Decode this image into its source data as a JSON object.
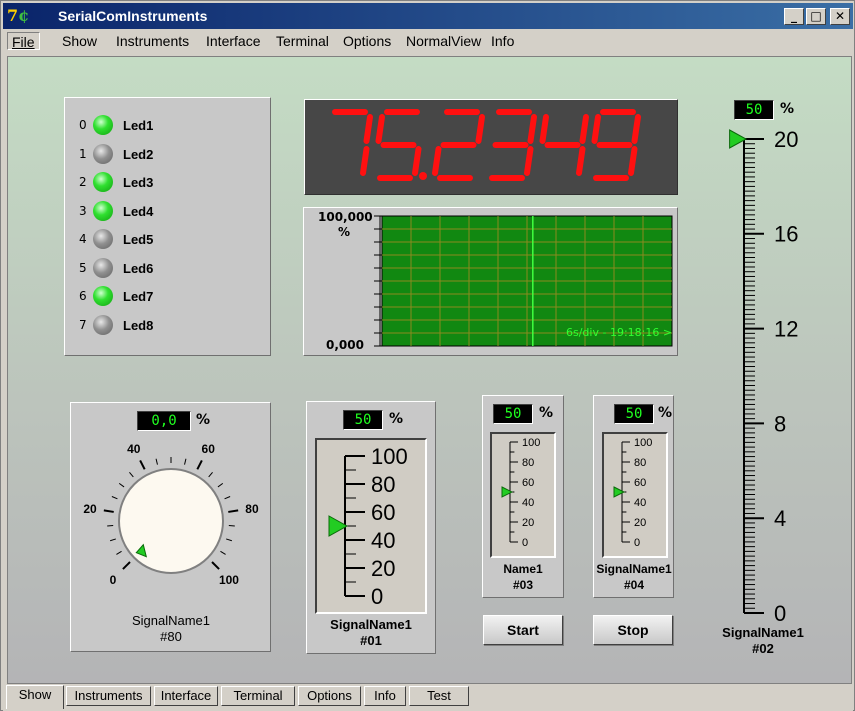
{
  "window": {
    "title": "SerialComInstruments",
    "min_glyph": "_",
    "max_glyph": "□",
    "close_glyph": "✕"
  },
  "menu": [
    {
      "label": "File"
    },
    {
      "label": "Show"
    },
    {
      "label": "Instruments"
    },
    {
      "label": "Interface"
    },
    {
      "label": "Terminal"
    },
    {
      "label": "Options"
    },
    {
      "label": "NormalView"
    },
    {
      "label": "Info"
    }
  ],
  "leds": [
    {
      "index": "0",
      "label": "Led1",
      "state": "on"
    },
    {
      "index": "1",
      "label": "Led2",
      "state": "off"
    },
    {
      "index": "2",
      "label": "Led3",
      "state": "on"
    },
    {
      "index": "3",
      "label": "Led4",
      "state": "on"
    },
    {
      "index": "4",
      "label": "Led5",
      "state": "off"
    },
    {
      "index": "5",
      "label": "Led6",
      "state": "off"
    },
    {
      "index": "6",
      "label": "Led7",
      "state": "on"
    },
    {
      "index": "7",
      "label": "Led8",
      "state": "off"
    }
  ],
  "seven_segment": {
    "value": "75.2349",
    "color": "#ff1010"
  },
  "scope": {
    "max_label": "100,000",
    "unit": "%",
    "min_label": "0,000",
    "timebase": "6s/div - 19:18:16 >"
  },
  "knob": {
    "value": "0,0",
    "unit": "%",
    "ticks": [
      "0",
      "20",
      "40",
      "60",
      "80",
      "100"
    ],
    "level": 0,
    "caption_name": "SignalName1",
    "caption_id": "#80"
  },
  "gauge01": {
    "value": "50",
    "unit": "%",
    "ticks": [
      "100",
      "80",
      "60",
      "40",
      "20",
      "0"
    ],
    "level": 50,
    "caption_name": "SignalName1",
    "caption_id": "#01"
  },
  "gauge03": {
    "value": "50",
    "unit": "%",
    "ticks": [
      "100",
      "80",
      "60",
      "40",
      "20",
      "0"
    ],
    "level": 50,
    "caption_name": "Name1",
    "caption_id": "#03"
  },
  "gauge04": {
    "value": "50",
    "unit": "%",
    "ticks": [
      "100",
      "80",
      "60",
      "40",
      "20",
      "0"
    ],
    "level": 50,
    "caption_name": "SignalName1",
    "caption_id": "#04"
  },
  "gauge02": {
    "value": "50",
    "unit": "%",
    "ticks": [
      "20",
      "16",
      "12",
      "8",
      "4",
      "0"
    ],
    "level": 100,
    "caption_name": "SignalName1",
    "caption_id": "#02"
  },
  "buttons": {
    "start": "Start",
    "stop": "Stop"
  },
  "tabs": [
    {
      "label": "Show",
      "active": true
    },
    {
      "label": "Instruments"
    },
    {
      "label": "Interface"
    },
    {
      "label": "Terminal"
    },
    {
      "label": "Options"
    },
    {
      "label": "Info"
    },
    {
      "label": "Test"
    }
  ],
  "colors": {
    "accent_green": "#20ff20",
    "pointer_green": "#22cc22",
    "scope_bg": "#118811"
  }
}
